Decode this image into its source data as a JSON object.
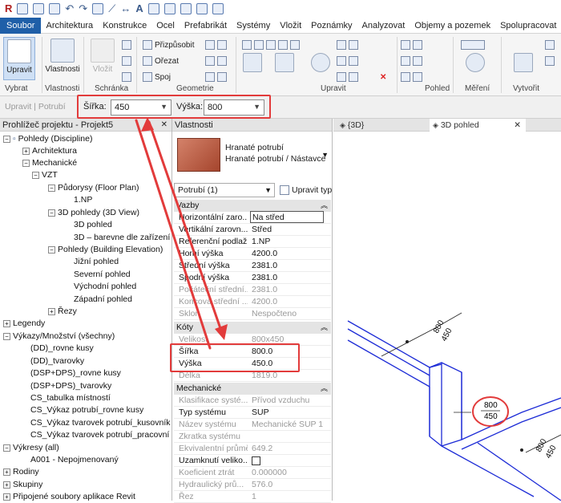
{
  "menu": {
    "tabs": [
      "Soubor",
      "Architektura",
      "Konstrukce",
      "Ocel",
      "Prefabrikát",
      "Systémy",
      "Vložit",
      "Poznámky",
      "Analyzovat",
      "Objemy a pozemek",
      "Spolupracovat"
    ]
  },
  "ribbon": {
    "upravit": "Upravit",
    "vlastnosti": "Vlastnosti",
    "vlozit": "Vložit",
    "prizpusobit": "Přizpůsobit",
    "orezat": "Ořezat",
    "spoj": "Spoj",
    "groups": {
      "vybrat": "Vybrat",
      "vlastnosti": "Vlastnosti",
      "schranka": "Schránka",
      "geometrie": "Geometrie",
      "upravit": "Upravit",
      "pohled": "Pohled",
      "mereni": "Měření",
      "vytvorit": "Vytvořit"
    }
  },
  "options": {
    "mode": "Upravit | Potrubí",
    "width_label": "Šířka:",
    "width_value": "450",
    "height_label": "Výška:",
    "height_value": "800"
  },
  "browser": {
    "title": "Prohlížeč projektu - Projekt5",
    "items": [
      "Pohledy (Discipline)",
      "Architektura",
      "Mechanické",
      "VZT",
      "Půdorysy (Floor Plan)",
      "1.NP",
      "3D pohledy (3D View)",
      "3D pohled",
      "3D – barevne dle zařízení",
      "Pohledy (Building Elevation)",
      "Jižní pohled",
      "Severní pohled",
      "Východní pohled",
      "Západní pohled",
      "Řezy",
      "Legendy",
      "Výkazy/Množství (všechny)",
      "(DD)_rovne kusy",
      "(DD)_tvarovky",
      "(DSP+DPS)_rovne kusy",
      "(DSP+DPS)_tvarovky",
      "CS_tabulka místností",
      "CS_Výkaz potrubí_rovne kusy",
      "CS_Výkaz tvarovek potrubí_kusovník",
      "CS_Výkaz tvarovek potrubí_pracovní",
      "Výkresy (all)",
      "A001 - Nepojmenovaný",
      "Rodiny",
      "Skupiny",
      "Připojené soubory aplikace Revit"
    ]
  },
  "properties": {
    "title": "Vlastnosti",
    "type_name": "Hranaté potrubí",
    "type_sub": "Hranaté potrubí / Nástavce",
    "filter": "Potrubí (1)",
    "edit_type": "Upravit typ",
    "sections": {
      "vazby": "Vazby",
      "koty": "Kóty",
      "mechanicke": "Mechanické"
    },
    "vazby": [
      {
        "k": "Horizontální zaro...",
        "v": "Na střed"
      },
      {
        "k": "Vertikální zarovn...",
        "v": "Střed"
      },
      {
        "k": "Referenční podlaží",
        "v": "1.NP"
      },
      {
        "k": "Horní výška",
        "v": "4200.0"
      },
      {
        "k": "Střední výška",
        "v": "2381.0"
      },
      {
        "k": "Spodní výška",
        "v": "2381.0"
      },
      {
        "k": "Počáteční střední...",
        "v": "2381.0"
      },
      {
        "k": "Koncová střední ...",
        "v": "4200.0"
      },
      {
        "k": "Sklon",
        "v": "Nespočteno"
      }
    ],
    "koty": [
      {
        "k": "Velikost",
        "v": "800x450"
      },
      {
        "k": "Šířka",
        "v": "800.0"
      },
      {
        "k": "Výška",
        "v": "450.0"
      },
      {
        "k": "Délka",
        "v": "1819.0"
      }
    ],
    "mech": [
      {
        "k": "Klasifikace systé...",
        "v": "Přívod vzduchu"
      },
      {
        "k": "Typ systému",
        "v": "SUP"
      },
      {
        "k": "Název systému",
        "v": "Mechanické SUP 1"
      },
      {
        "k": "Zkratka systému",
        "v": ""
      },
      {
        "k": "Ekvivalentní průměr",
        "v": "649.2"
      },
      {
        "k": "Uzamknutí veliko...",
        "v": ""
      },
      {
        "k": "Koeficient ztrát",
        "v": "0.000000"
      },
      {
        "k": "Hydraulický prů...",
        "v": "576.0"
      },
      {
        "k": "Řez",
        "v": "1"
      }
    ]
  },
  "view": {
    "tab1": "{3D}",
    "tab2": "3D pohled",
    "dim1": "800",
    "dim2": "450",
    "tag_w": "800",
    "tag_h": "450"
  },
  "colors": {
    "accent": "#1f5fa8",
    "annotation": "#e23b3b",
    "duct": "#1c2bd6"
  }
}
